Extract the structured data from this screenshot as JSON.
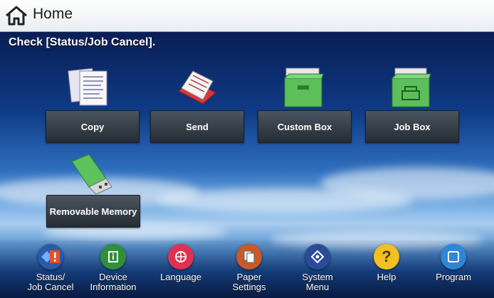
{
  "header": {
    "title": "Home"
  },
  "message": "Check [Status/Job Cancel].",
  "tiles": [
    {
      "label": "Copy"
    },
    {
      "label": "Send"
    },
    {
      "label": "Custom Box"
    },
    {
      "label": "Job Box"
    },
    {
      "label": "Removable Memory"
    }
  ],
  "bottom": [
    {
      "label": "Status/\nJob Cancel"
    },
    {
      "label": "Device\nInformation"
    },
    {
      "label": "Language"
    },
    {
      "label": "Paper\nSettings"
    },
    {
      "label": "System\nMenu"
    },
    {
      "label": "Help"
    },
    {
      "label": "Program"
    }
  ],
  "colors": {
    "status_badge": "#e8502a",
    "device": "#2f8f3a",
    "language": "#e03250",
    "paper": "#d0d0d0",
    "system": "#2a4a9a",
    "help": "#f2c020",
    "program": "#2e86d6"
  }
}
